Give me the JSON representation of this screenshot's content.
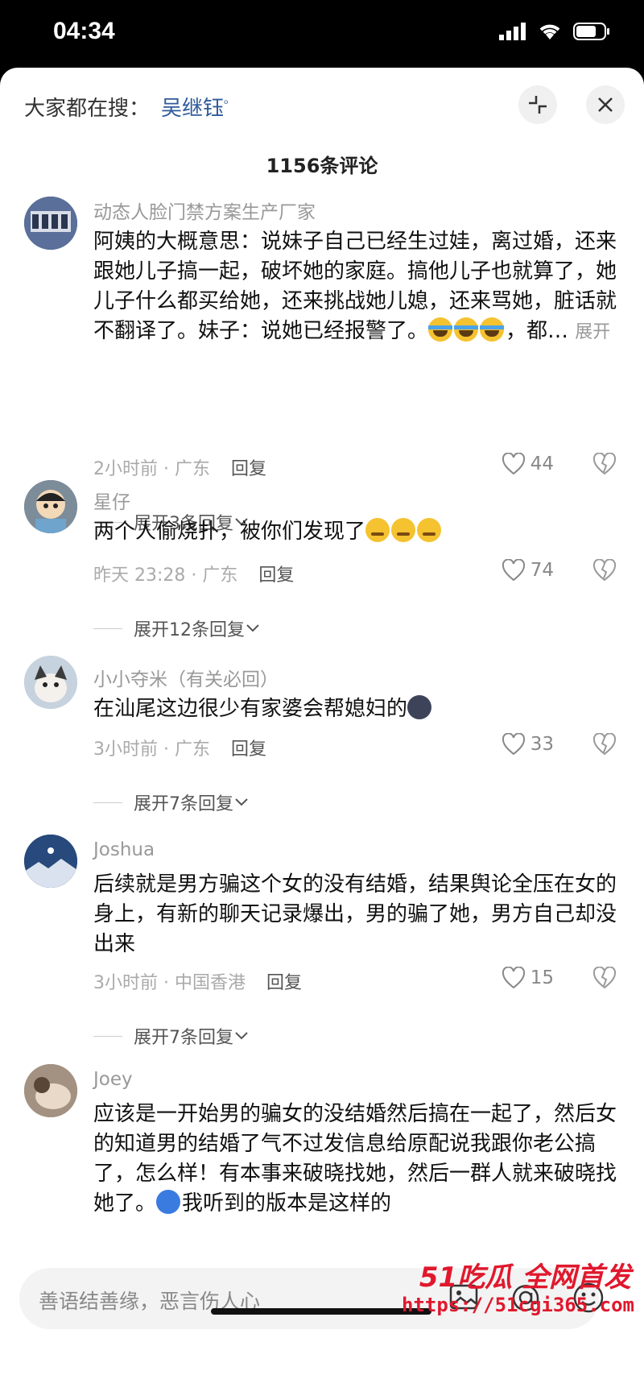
{
  "status_bar": {
    "time": "04:34"
  },
  "header": {
    "search_label": "大家都在搜：",
    "search_keyword": "吴继钰",
    "collapse_icon": "collapse-icon",
    "close_icon": "close-icon"
  },
  "comment_count": "1156条评论",
  "comments": [
    {
      "user": "动态人脸门禁方案生产厂家",
      "text": "阿姨的大概意思：说妹子自己已经生过娃，离过婚，还来跟她儿子搞一起，破坏她的家庭。搞他儿子也就算了，她儿子什么都买给她，还来挑战她儿媳，还来骂她，脏话就不翻译了。妹子：说她已经报警了。",
      "text_tail": "，都…",
      "more": "展开",
      "time_loc": "2小时前 · 广东",
      "reply": "回复",
      "likes": "44",
      "expand": "展开3条回复"
    },
    {
      "user": "星仔",
      "text": "两个人偷烧扑，被你们发现了",
      "time_loc": "昨天 23:28 · 广东",
      "reply": "回复",
      "likes": "74",
      "expand": "展开12条回复"
    },
    {
      "user": "小小夺米（有关必回）",
      "text": "在汕尾这边很少有家婆会帮媳妇的",
      "time_loc": "3小时前 · 广东",
      "reply": "回复",
      "likes": "33",
      "expand": "展开7条回复"
    },
    {
      "user": "Joshua",
      "text": "后续就是男方骗这个女的没有结婚，结果舆论全压在女的身上，有新的聊天记录爆出，男的骗了她，男方自己却没出来",
      "time_loc": "3小时前 · 中国香港",
      "reply": "回复",
      "likes": "15",
      "expand": "展开7条回复"
    },
    {
      "user": "Joey",
      "text": "应该是一开始男的骗女的没结婚然后搞在一起了，然后女的知道男的结婚了气不过发信息给原配说我跟你老公搞了，怎么样！有本事来破晓找她，然后一群人就来破晓找她了。",
      "text_tail": "我听到的版本是这样的"
    }
  ],
  "input": {
    "placeholder": "善语结善缘，恶言伤人心",
    "icons": [
      "image-icon",
      "at-icon",
      "emoji-icon"
    ]
  },
  "watermark": {
    "line1": "51吃瓜 全网首发",
    "line2": "https://51cgi365.com"
  }
}
